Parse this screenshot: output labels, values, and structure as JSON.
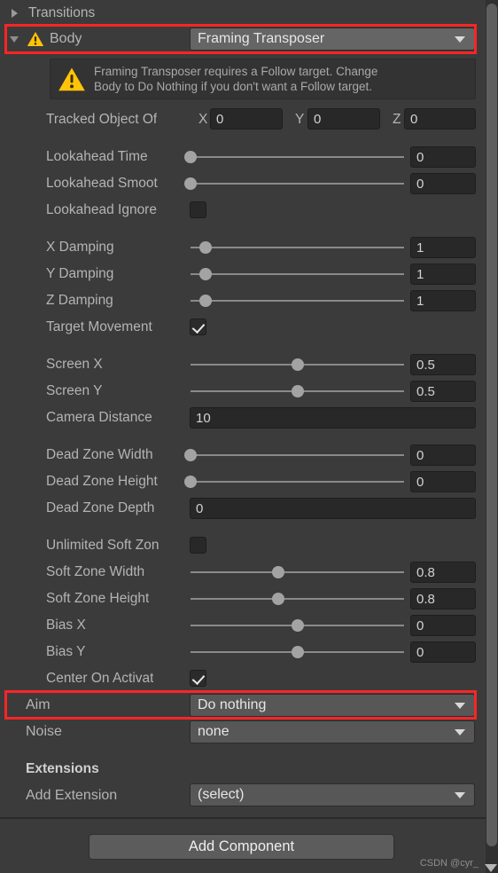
{
  "panel": {
    "transitions_label": "Transitions",
    "body_label": "Body",
    "body_value": "Framing Transposer",
    "warning_text": "Framing Transposer requires a Follow target.  Change\nBody to Do Nothing if you don't want a Follow target.",
    "aim_label": "Aim",
    "aim_value": "Do nothing",
    "noise_label": "Noise",
    "noise_value": "none",
    "extensions_header": "Extensions",
    "add_extension_label": "Add Extension",
    "add_extension_value": "(select)",
    "add_component_label": "Add Component",
    "watermark": "CSDN @cyr_"
  },
  "tracked_offset": {
    "label": "Tracked Object Of",
    "x_label": "X",
    "x_value": "0",
    "y_label": "Y",
    "y_value": "0",
    "z_label": "Z",
    "z_value": "0"
  },
  "fields": [
    {
      "name": "lookahead-time",
      "label": "Lookahead Time",
      "type": "slider",
      "value": "0",
      "fill": 0.0
    },
    {
      "name": "lookahead-smoothing",
      "label": "Lookahead Smoot",
      "type": "slider",
      "value": "0",
      "fill": 0.0
    },
    {
      "name": "lookahead-ignore-y",
      "label": "Lookahead Ignore",
      "type": "checkbox",
      "value": false
    },
    {
      "name": "x-damping",
      "label": "X Damping",
      "type": "slider",
      "value": "1",
      "fill": 0.07
    },
    {
      "name": "y-damping",
      "label": "Y Damping",
      "type": "slider",
      "value": "1",
      "fill": 0.07
    },
    {
      "name": "z-damping",
      "label": "Z Damping",
      "type": "slider",
      "value": "1",
      "fill": 0.07
    },
    {
      "name": "target-movement-only",
      "label": "Target Movement",
      "type": "checkbox",
      "value": true
    },
    {
      "name": "screen-x",
      "label": "Screen X",
      "type": "slider",
      "value": "0.5",
      "fill": 0.5
    },
    {
      "name": "screen-y",
      "label": "Screen Y",
      "type": "slider",
      "value": "0.5",
      "fill": 0.5
    },
    {
      "name": "camera-distance",
      "label": "Camera Distance",
      "type": "wide",
      "value": "10"
    },
    {
      "name": "dead-zone-width",
      "label": "Dead Zone Width",
      "type": "slider",
      "value": "0",
      "fill": 0.0
    },
    {
      "name": "dead-zone-height",
      "label": "Dead Zone Height",
      "type": "slider",
      "value": "0",
      "fill": 0.0
    },
    {
      "name": "dead-zone-depth",
      "label": "Dead Zone Depth",
      "type": "wide",
      "value": "0"
    },
    {
      "name": "unlimited-soft-zone",
      "label": "Unlimited Soft Zon",
      "type": "checkbox",
      "value": false
    },
    {
      "name": "soft-zone-width",
      "label": "Soft Zone Width",
      "type": "slider",
      "value": "0.8",
      "fill": 0.41
    },
    {
      "name": "soft-zone-height",
      "label": "Soft Zone Height",
      "type": "slider",
      "value": "0.8",
      "fill": 0.41
    },
    {
      "name": "bias-x",
      "label": "Bias X",
      "type": "slider",
      "value": "0",
      "fill": 0.5
    },
    {
      "name": "bias-y",
      "label": "Bias Y",
      "type": "slider",
      "value": "0",
      "fill": 0.5
    },
    {
      "name": "center-on-activate",
      "label": "Center On Activat",
      "type": "checkbox",
      "value": true
    }
  ],
  "colors": {
    "panel_bg": "#3b3b3b",
    "field_bg": "#282828",
    "dropdown_bg": "#656565",
    "highlight": "#fb2525",
    "warning_yellow": "#ffc107",
    "text": "#b4b4b4"
  }
}
